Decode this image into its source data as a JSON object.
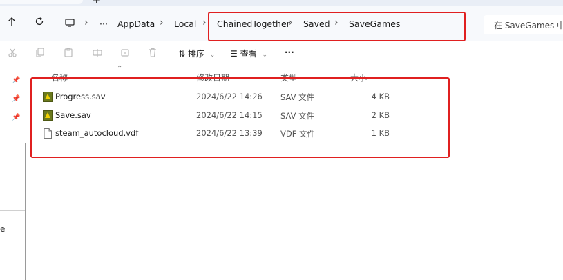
{
  "tabstrip": {
    "new_tab_icon": "+"
  },
  "nav": {
    "back_icon": "←",
    "up_icon": "↑",
    "refresh_icon": "⟳"
  },
  "breadcrumb": {
    "more": "···",
    "items": [
      "AppData",
      "Local",
      "ChainedTogether",
      "Saved",
      "SaveGames"
    ]
  },
  "search": {
    "placeholder": "在 SaveGames 中搜"
  },
  "toolbar": {
    "sort_label": "排序",
    "view_label": "查看",
    "more_label": "···"
  },
  "columns": {
    "name": "名称",
    "date": "修改日期",
    "type": "类型",
    "size": "大小"
  },
  "files": [
    {
      "name": "Progress.sav",
      "date": "2024/6/22 14:26",
      "type": "SAV 文件",
      "size": "4 KB",
      "icon": "game-save-icon"
    },
    {
      "name": "Save.sav",
      "date": "2024/6/22 14:15",
      "type": "SAV 文件",
      "size": "2 KB",
      "icon": "game-save-icon"
    },
    {
      "name": "steam_autocloud.vdf",
      "date": "2024/6/22 13:39",
      "type": "VDF 文件",
      "size": "1 KB",
      "icon": "document-icon"
    }
  ],
  "left_pane": {
    "edge_text": "e"
  },
  "colors": {
    "annotation": "#e02020",
    "accent": "#0067c0"
  }
}
